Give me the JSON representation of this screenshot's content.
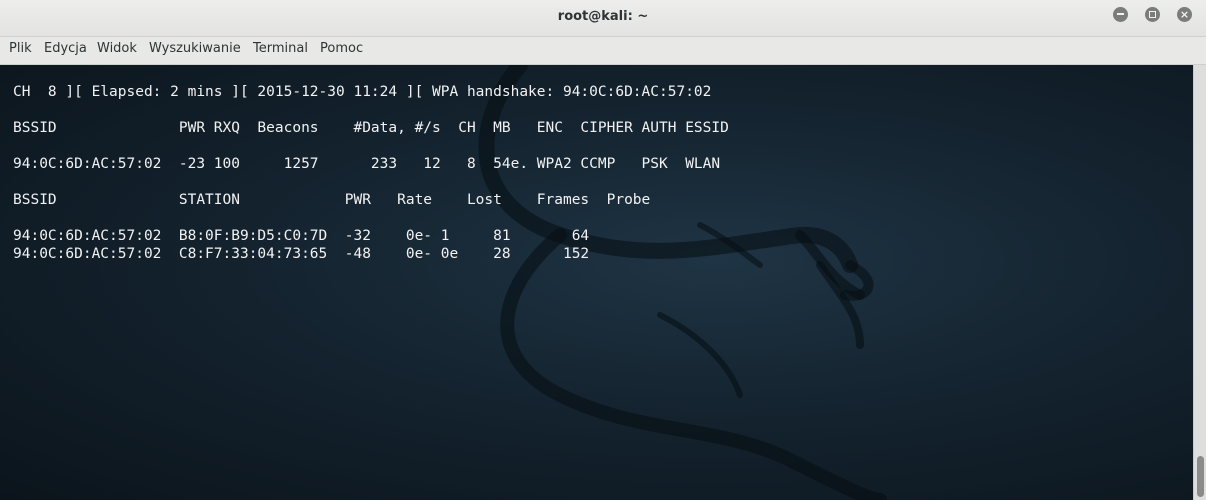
{
  "window": {
    "title": "root@kali: ~",
    "controls": {
      "minimize_icon": "minimize-icon",
      "maximize_icon": "maximize-icon",
      "close_icon": "close-icon",
      "close_glyph": "×"
    }
  },
  "menubar": {
    "items": [
      {
        "label": "Plik"
      },
      {
        "label": "Edycja"
      },
      {
        "label": "Widok"
      },
      {
        "label": "Wyszukiwanie"
      },
      {
        "label": "Terminal"
      },
      {
        "label": "Pomoc"
      }
    ]
  },
  "terminal": {
    "lines": [
      "CH  8 ][ Elapsed: 2 mins ][ 2015-12-30 11:24 ][ WPA handshake: 94:0C:6D:AC:57:02",
      "",
      "BSSID              PWR RXQ  Beacons    #Data, #/s  CH  MB   ENC  CIPHER AUTH ESSID",
      "",
      "94:0C:6D:AC:57:02  -23 100     1257      233   12   8  54e. WPA2 CCMP   PSK  WLAN",
      "",
      "BSSID              STATION            PWR   Rate    Lost    Frames  Probe",
      "",
      "94:0C:6D:AC:57:02  B8:0F:B9:D5:C0:7D  -32    0e- 1     81       64",
      "94:0C:6D:AC:57:02  C8:F7:33:04:73:65  -48    0e- 0e    28      152"
    ]
  },
  "scrollbar": {
    "position_fraction": 0.95
  },
  "colors": {
    "terminal_text": "#f2f2f2",
    "terminal_bg": "#14232f",
    "titlebar_bg": "#e8e8e7"
  }
}
